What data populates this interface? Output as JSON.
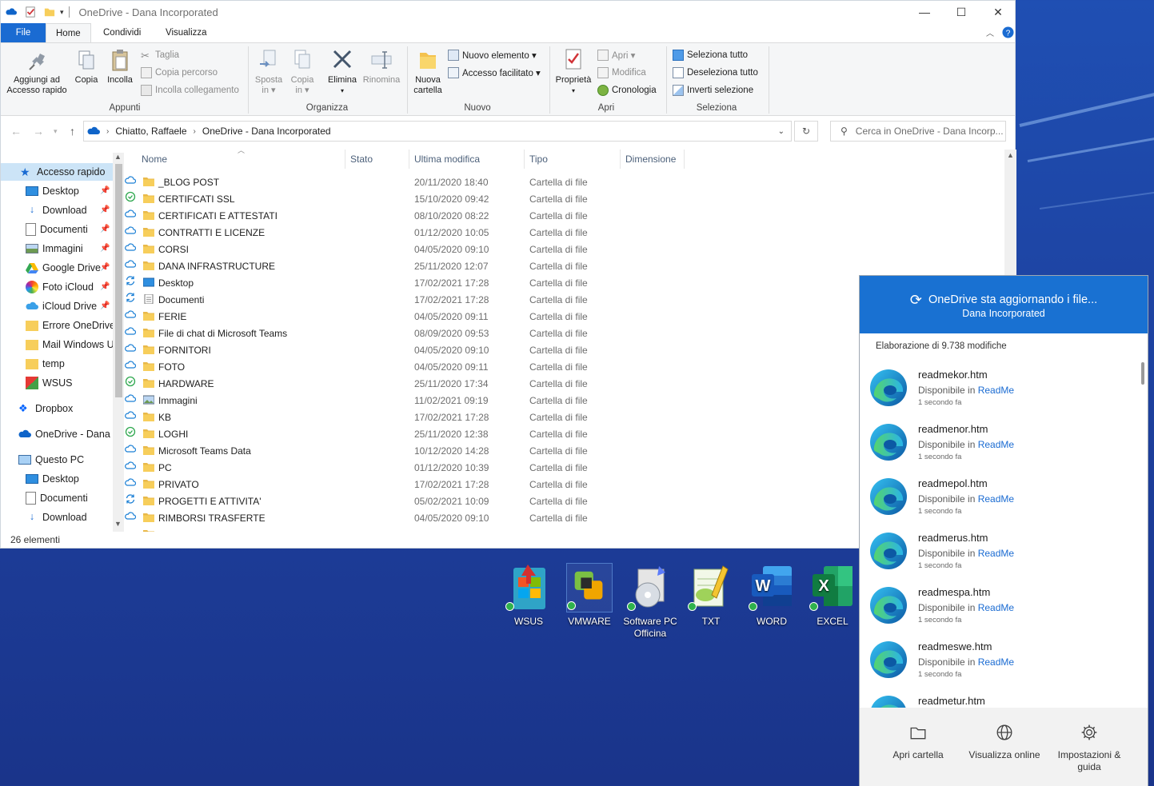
{
  "window": {
    "title": "OneDrive - Dana Incorporated",
    "controls": [
      "—",
      "☐",
      "✕"
    ]
  },
  "ribbon": {
    "tabs": [
      "File",
      "Home",
      "Condividi",
      "Visualizza"
    ],
    "appunti": {
      "pin": [
        "Aggiungi ad",
        "Accesso rapido"
      ],
      "copy": "Copia",
      "paste": "Incolla",
      "cut": "Taglia",
      "copy_path": "Copia percorso",
      "paste_link": "Incolla collegamento",
      "label": "Appunti"
    },
    "organizza": {
      "move": [
        "Sposta",
        "in ▾"
      ],
      "copy_to": [
        "Copia",
        "in ▾"
      ],
      "delete": "Elimina",
      "rename": "Rinomina",
      "label": "Organizza"
    },
    "nuovo": {
      "new_folder": [
        "Nuova",
        "cartella"
      ],
      "new_item": "Nuovo elemento ▾",
      "easy_access": "Accesso facilitato ▾",
      "label": "Nuovo"
    },
    "apri": {
      "properties": "Proprietà",
      "open": "Apri ▾",
      "edit": "Modifica",
      "history": "Cronologia",
      "label": "Apri"
    },
    "seleziona": {
      "select_all": "Seleziona tutto",
      "select_none": "Deseleziona tutto",
      "invert": "Inverti selezione",
      "label": "Seleziona"
    }
  },
  "address": {
    "path": [
      "Chiatto, Raffaele",
      "OneDrive - Dana Incorporated"
    ],
    "search_placeholder": "Cerca in OneDrive - Dana Incorp..."
  },
  "nav": {
    "quick_access": "Accesso rapido",
    "pinned": [
      "Desktop",
      "Download",
      "Documenti",
      "Immagini",
      "Google Drive",
      "Foto iCloud",
      "iCloud Drive"
    ],
    "recent": [
      "Errore OneDrive",
      "Mail Windows U",
      "temp",
      "WSUS"
    ],
    "dropbox": "Dropbox",
    "onedrive": "OneDrive - Dana I",
    "this_pc": "Questo PC",
    "pc_items": [
      "Desktop",
      "Documenti",
      "Download"
    ]
  },
  "columns": [
    "Nome",
    "Stato",
    "Ultima modifica",
    "Tipo",
    "Dimensione"
  ],
  "files": [
    {
      "name": "_BLOG POST",
      "status": "cloud",
      "date": "20/11/2020 18:40",
      "type": "Cartella di file",
      "icon": "folder"
    },
    {
      "name": "CERTIFCATI SSL",
      "status": "ok",
      "date": "15/10/2020 09:42",
      "type": "Cartella di file",
      "icon": "folder"
    },
    {
      "name": "CERTIFICATI E ATTESTATI",
      "status": "cloud",
      "date": "08/10/2020 08:22",
      "type": "Cartella di file",
      "icon": "folder"
    },
    {
      "name": "CONTRATTI E LICENZE",
      "status": "cloud",
      "date": "01/12/2020 10:05",
      "type": "Cartella di file",
      "icon": "folder"
    },
    {
      "name": "CORSI",
      "status": "cloud",
      "date": "04/05/2020 09:10",
      "type": "Cartella di file",
      "icon": "folder"
    },
    {
      "name": "DANA INFRASTRUCTURE",
      "status": "cloud",
      "date": "25/11/2020 12:07",
      "type": "Cartella di file",
      "icon": "folder"
    },
    {
      "name": "Desktop",
      "status": "sync",
      "date": "17/02/2021 17:28",
      "type": "Cartella di file",
      "icon": "desktop"
    },
    {
      "name": "Documenti",
      "status": "sync",
      "date": "17/02/2021 17:28",
      "type": "Cartella di file",
      "icon": "docs"
    },
    {
      "name": "FERIE",
      "status": "cloud",
      "date": "04/05/2020 09:11",
      "type": "Cartella di file",
      "icon": "folder"
    },
    {
      "name": "File di chat di Microsoft Teams",
      "status": "cloud",
      "date": "08/09/2020 09:53",
      "type": "Cartella di file",
      "icon": "folder"
    },
    {
      "name": "FORNITORI",
      "status": "cloud",
      "date": "04/05/2020 09:10",
      "type": "Cartella di file",
      "icon": "folder"
    },
    {
      "name": "FOTO",
      "status": "cloud",
      "date": "04/05/2020 09:11",
      "type": "Cartella di file",
      "icon": "folder"
    },
    {
      "name": "HARDWARE",
      "status": "ok",
      "date": "25/11/2020 17:34",
      "type": "Cartella di file",
      "icon": "folder"
    },
    {
      "name": "Immagini",
      "status": "cloud",
      "date": "11/02/2021 09:19",
      "type": "Cartella di file",
      "icon": "images"
    },
    {
      "name": "KB",
      "status": "cloud",
      "date": "17/02/2021 17:28",
      "type": "Cartella di file",
      "icon": "folder"
    },
    {
      "name": "LOGHI",
      "status": "ok",
      "date": "25/11/2020 12:38",
      "type": "Cartella di file",
      "icon": "folder"
    },
    {
      "name": "Microsoft Teams Data",
      "status": "cloud",
      "date": "10/12/2020 14:28",
      "type": "Cartella di file",
      "icon": "folder"
    },
    {
      "name": "PC",
      "status": "cloud",
      "date": "01/12/2020 10:39",
      "type": "Cartella di file",
      "icon": "folder"
    },
    {
      "name": "PRIVATO",
      "status": "cloud",
      "date": "17/02/2021 17:28",
      "type": "Cartella di file",
      "icon": "folder"
    },
    {
      "name": "PROGETTI E ATTIVITA'",
      "status": "sync",
      "date": "05/02/2021 10:09",
      "type": "Cartella di file",
      "icon": "folder"
    },
    {
      "name": "RIMBORSI TRASFERTE",
      "status": "cloud",
      "date": "04/05/2020 09:10",
      "type": "Cartella di file",
      "icon": "folder"
    }
  ],
  "status_bar": "26 elementi",
  "desktop_icons": [
    {
      "label": "WSUS",
      "icon": "wsus-icon"
    },
    {
      "label": "VMWARE",
      "icon": "vmware-icon"
    },
    {
      "label": "Software PC Officina",
      "icon": "software-cd-icon"
    },
    {
      "label": "TXT",
      "icon": "notepad-icon"
    },
    {
      "label": "WORD",
      "icon": "word-icon"
    },
    {
      "label": "EXCEL",
      "icon": "excel-icon"
    }
  ],
  "onedrive_flyout": {
    "title": "OneDrive sta aggiornando i file...",
    "subtitle": "Dana Incorporated",
    "progress": "Elaborazione di 9.738 modifiche",
    "items": [
      {
        "name": "readmekor.htm",
        "available": "Disponibile in",
        "location": "ReadMe",
        "time": "1 secondo fa"
      },
      {
        "name": "readmenor.htm",
        "available": "Disponibile in",
        "location": "ReadMe",
        "time": "1 secondo fa"
      },
      {
        "name": "readmepol.htm",
        "available": "Disponibile in",
        "location": "ReadMe",
        "time": "1 secondo fa"
      },
      {
        "name": "readmerus.htm",
        "available": "Disponibile in",
        "location": "ReadMe",
        "time": "1 secondo fa"
      },
      {
        "name": "readmespa.htm",
        "available": "Disponibile in",
        "location": "ReadMe",
        "time": "1 secondo fa"
      },
      {
        "name": "readmeswe.htm",
        "available": "Disponibile in",
        "location": "ReadMe",
        "time": "1 secondo fa"
      },
      {
        "name": "readmetur.htm",
        "available": "",
        "location": "",
        "time": ""
      }
    ],
    "footer": [
      "Apri cartella",
      "Visualizza online",
      "Impostazioni &",
      "guida"
    ]
  },
  "colors": {
    "accent": "#1a6bd2",
    "flyout_header": "#1971d2",
    "desktop": "#1f4fb3",
    "folder": "#f7ce5b",
    "sync_ok": "#2fb24c"
  }
}
